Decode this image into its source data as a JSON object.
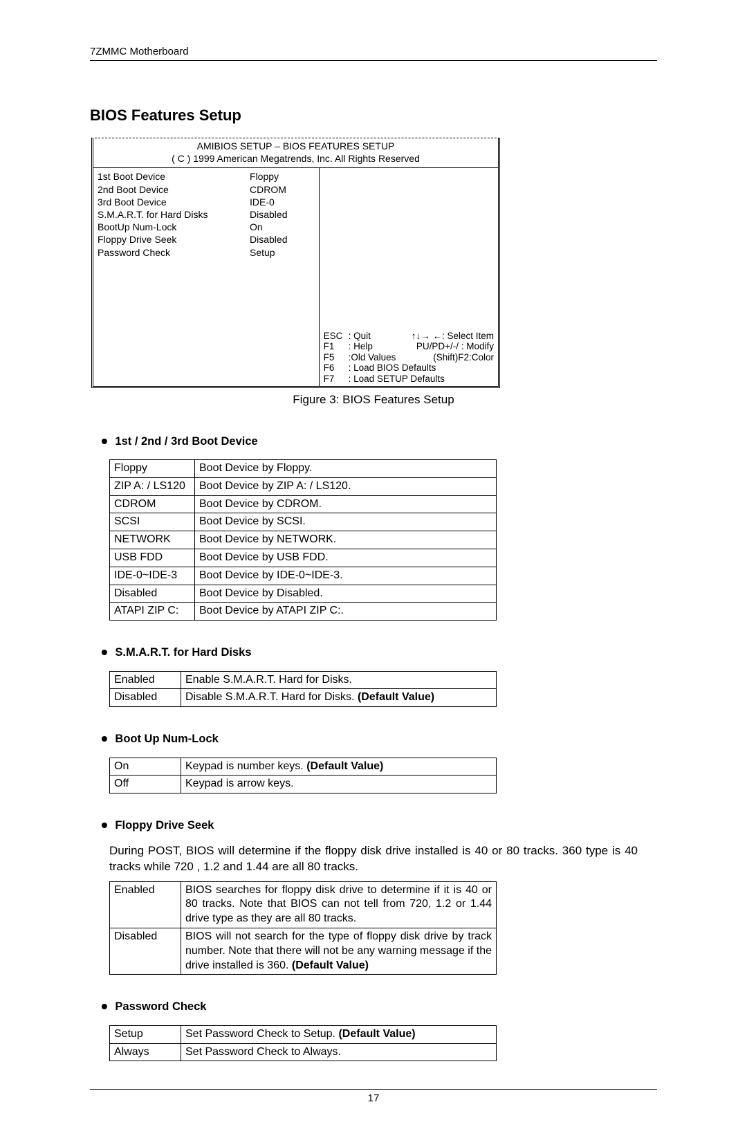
{
  "running_header": "7ZMMC Motherboard",
  "section_title": "BIOS Features Setup",
  "figure_caption": "Figure 3: BIOS Features Setup",
  "page_number": "17",
  "bios_box": {
    "title1": "AMIBIOS SETUP – BIOS FEATURES SETUP",
    "title2": "( C ) 1999 American Megatrends, Inc. All Rights Reserved",
    "rows": [
      {
        "k": "1st Boot Device",
        "v": "Floppy"
      },
      {
        "k": "2nd Boot Device",
        "v": "CDROM"
      },
      {
        "k": "3rd Boot Device",
        "v": "IDE-0"
      },
      {
        "k": "S.M.A.R.T. for Hard Disks",
        "v": "Disabled"
      },
      {
        "k": "BootUp Num-Lock",
        "v": "On"
      },
      {
        "k": "Floppy Drive Seek",
        "v": "Disabled"
      },
      {
        "k": "Password Check",
        "v": "Setup"
      }
    ],
    "hints": [
      {
        "c1": "ESC",
        "c2": ": Quit",
        "c3": "↑↓→ ←: Select Item"
      },
      {
        "c1": "F1",
        "c2": ": Help",
        "c3": "PU/PD+/-/ : Modify"
      },
      {
        "c1": "F5",
        "c2": ":Old  Values",
        "c3": "(Shift)F2:Color"
      },
      {
        "c1": "F6",
        "c2": ": Load BIOS Defaults",
        "c3": ""
      },
      {
        "c1": "F7",
        "c2": ": Load SETUP Defaults",
        "c3": ""
      }
    ]
  },
  "boot_device_heading": "1st / 2nd / 3rd Boot Device",
  "boot_device_table": [
    {
      "k": "Floppy",
      "v": "Boot Device by Floppy."
    },
    {
      "k": "ZIP A: / LS120",
      "v": "Boot Device by ZIP A: / LS120."
    },
    {
      "k": "CDROM",
      "v": "Boot Device by CDROM."
    },
    {
      "k": "SCSI",
      "v": "Boot Device by SCSI."
    },
    {
      "k": "NETWORK",
      "v": "Boot Device by NETWORK."
    },
    {
      "k": "USB FDD",
      "v": "Boot Device by USB FDD."
    },
    {
      "k": "IDE-0~IDE-3",
      "v": "Boot Device by IDE-0~IDE-3."
    },
    {
      "k": "Disabled",
      "v": "Boot Device by Disabled."
    },
    {
      "k": "ATAPI ZIP C:",
      "v": "Boot Device by ATAPI ZIP C:."
    }
  ],
  "smart_heading": "S.M.A.R.T. for Hard Disks",
  "smart_table": [
    {
      "k": "Enabled",
      "v": "Enable S.M.A.R.T. Hard for Disks."
    },
    {
      "k": "Disabled",
      "v_pre": "Disable S.M.A.R.T. Hard for Disks. ",
      "v_bold": "(Default Value)"
    }
  ],
  "numlock_heading": "Boot Up Num-Lock",
  "numlock_table": [
    {
      "k": "On",
      "v_pre": "Keypad is number keys. ",
      "v_bold": "(Default Value)"
    },
    {
      "k": "Off",
      "v": "Keypad is arrow keys."
    }
  ],
  "floppy_heading": "Floppy Drive Seek",
  "floppy_desc": "During POST, BIOS will determine if the floppy disk drive installed is 40 or 80 tracks. 360 type is 40 tracks while 720 , 1.2 and 1.44 are all 80 tracks.",
  "floppy_table": [
    {
      "k": "Enabled",
      "v": "BIOS searches for floppy disk drive to determine if it is 40 or 80 tracks. Note that BIOS can not tell from 720, 1.2 or 1.44 drive type as they are all 80 tracks."
    },
    {
      "k": "Disabled",
      "v_pre": "BIOS will not search for the type of floppy disk drive by track number. Note that there will not be any warning message if the drive installed is 360. ",
      "v_bold": "(Default Value)"
    }
  ],
  "pwd_heading": "Password Check",
  "pwd_table": [
    {
      "k": "Setup",
      "v_pre": "Set Password Check to Setup. ",
      "v_bold": "(Default Value)"
    },
    {
      "k": "Always",
      "v": "Set Password Check to Always."
    }
  ]
}
